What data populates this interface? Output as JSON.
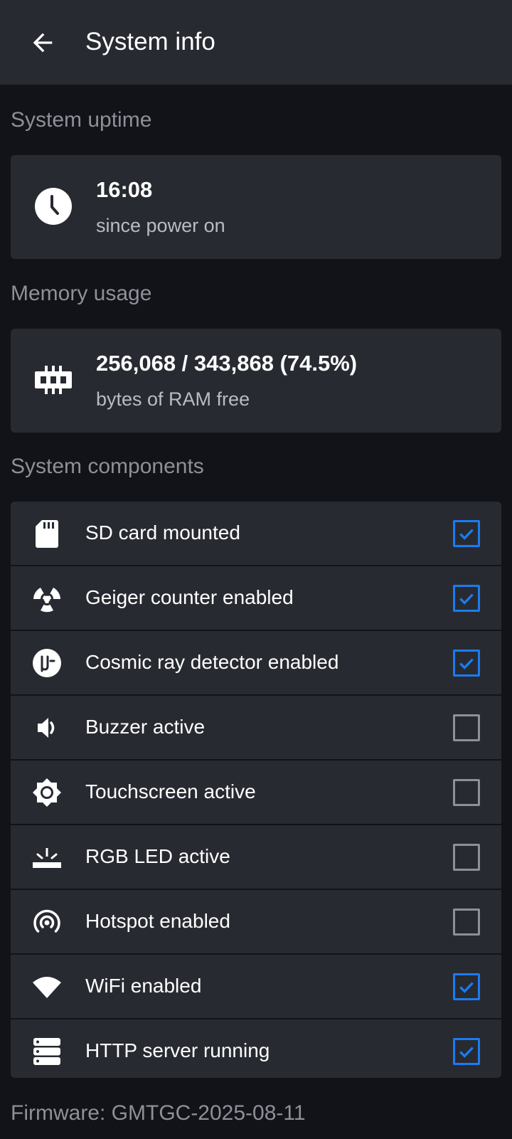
{
  "header": {
    "title": "System info",
    "back_icon": "arrow-back-icon"
  },
  "uptime": {
    "heading": "System uptime",
    "value": "16:08",
    "caption": "since power on",
    "icon": "clock-icon"
  },
  "memory": {
    "heading": "Memory usage",
    "value": "256,068 / 343,868 (74.5%)",
    "caption": "bytes of RAM free",
    "icon": "memory-icon"
  },
  "components": {
    "heading": "System components",
    "items": [
      {
        "label": "SD card mounted",
        "checked": true,
        "icon": "sd-card-icon"
      },
      {
        "label": "Geiger counter enabled",
        "checked": true,
        "icon": "radiation-icon"
      },
      {
        "label": "Cosmic ray detector enabled",
        "checked": true,
        "icon": "mu-icon"
      },
      {
        "label": "Buzzer active",
        "checked": false,
        "icon": "speaker-icon"
      },
      {
        "label": "Touchscreen active",
        "checked": false,
        "icon": "brightness-icon"
      },
      {
        "label": "RGB LED active",
        "checked": false,
        "icon": "light-icon"
      },
      {
        "label": "Hotspot enabled",
        "checked": false,
        "icon": "hotspot-icon"
      },
      {
        "label": "WiFi enabled",
        "checked": true,
        "icon": "wifi-icon"
      },
      {
        "label": "HTTP server running",
        "checked": true,
        "icon": "server-icon"
      }
    ]
  },
  "footer": {
    "firmware": "Firmware: GMTGC-2025-08-11"
  },
  "colors": {
    "background": "#111318",
    "surface": "#282a31",
    "accent": "#1a7cf2",
    "muted_text": "#8e9099"
  }
}
